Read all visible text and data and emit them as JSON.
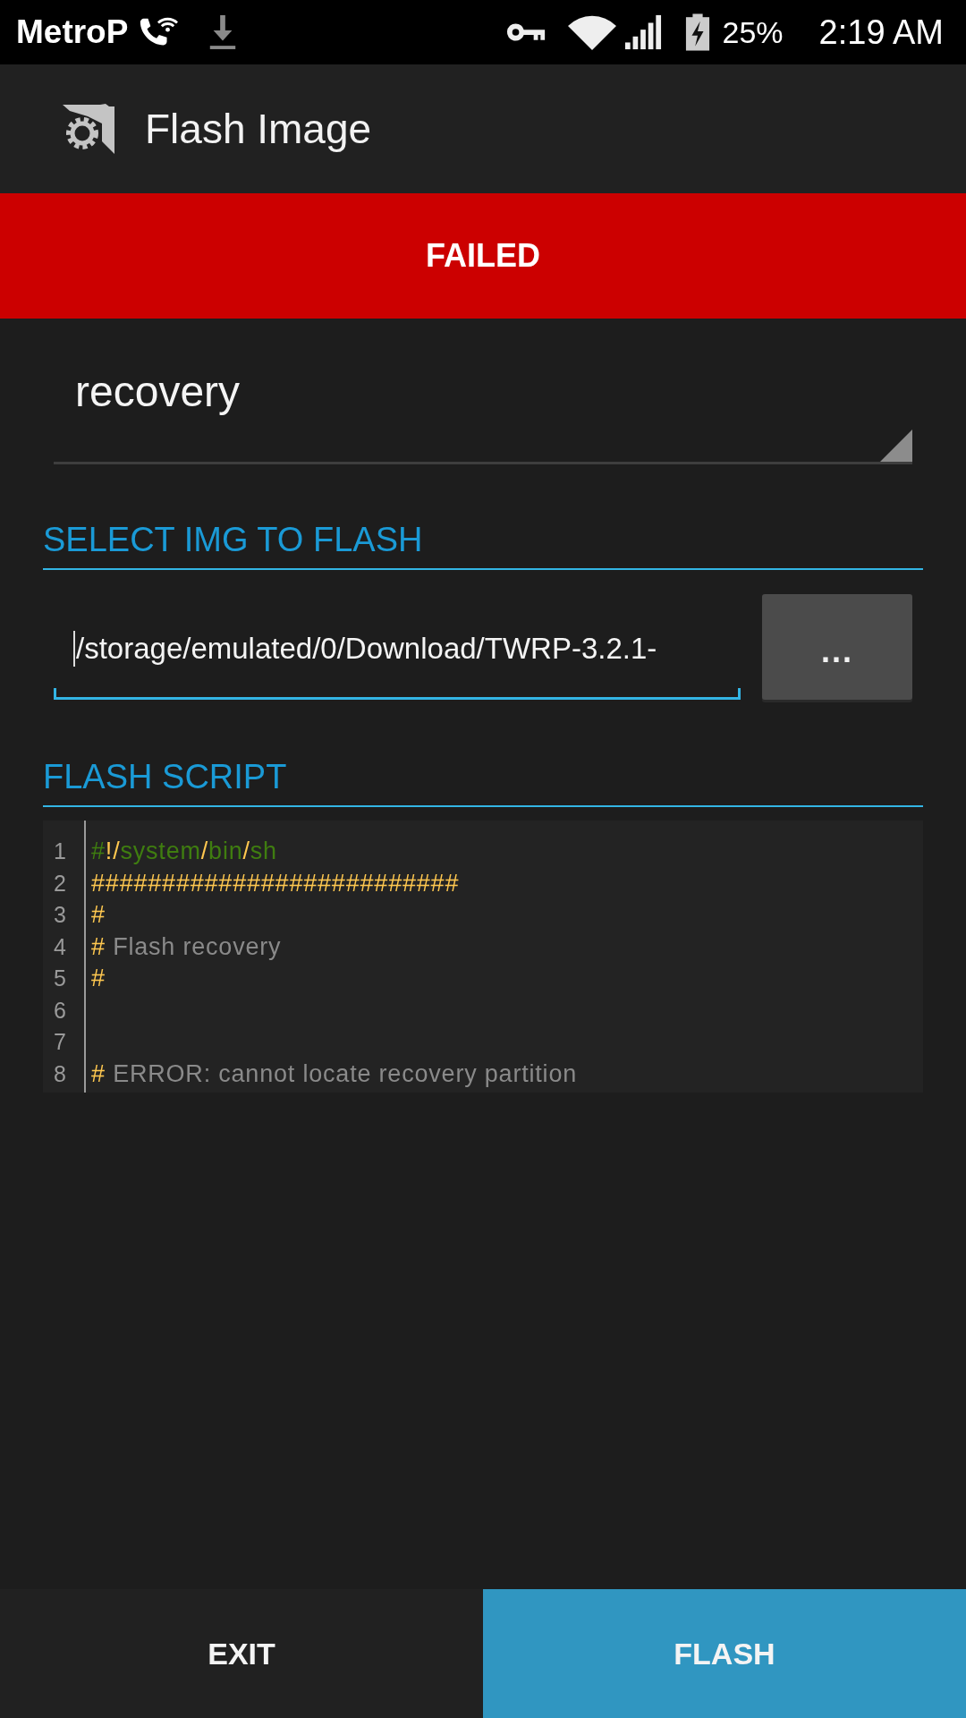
{
  "status_bar": {
    "carrier": "MetroP",
    "battery": "25%",
    "time": "2:19 AM"
  },
  "app_bar": {
    "title": "Flash Image"
  },
  "banner": {
    "label": "FAILED",
    "kind": "error"
  },
  "partition_dropdown": {
    "value": "recovery"
  },
  "select_image": {
    "header": "SELECT IMG TO FLASH",
    "path_field": {
      "value": "/storage/emulated/0/Download/TWRP-3.2.1-",
      "focused": true
    },
    "browse_button": {
      "label": "..."
    }
  },
  "flash_script": {
    "header": "FLASH SCRIPT",
    "lines": [
      {
        "number": "1",
        "tokens": [
          {
            "text": "#",
            "kind": "shebang"
          },
          {
            "text": "!/",
            "kind": "symbol"
          },
          {
            "text": "system",
            "kind": "shebang"
          },
          {
            "text": "/",
            "kind": "symbol"
          },
          {
            "text": "bin",
            "kind": "shebang"
          },
          {
            "text": "/",
            "kind": "symbol"
          },
          {
            "text": "sh",
            "kind": "shebang"
          }
        ]
      },
      {
        "number": "2",
        "tokens": [
          {
            "text": "##########################",
            "kind": "symbol"
          }
        ]
      },
      {
        "number": "3",
        "tokens": [
          {
            "text": "#",
            "kind": "symbol"
          }
        ]
      },
      {
        "number": "4",
        "tokens": [
          {
            "text": "#",
            "kind": "symbol"
          },
          {
            "text": " Flash recovery",
            "kind": "comment"
          }
        ]
      },
      {
        "number": "5",
        "tokens": [
          {
            "text": "#",
            "kind": "symbol"
          }
        ]
      },
      {
        "number": "6"
      },
      {
        "number": "7"
      },
      {
        "number": "8",
        "tokens": [
          {
            "text": "#",
            "kind": "symbol"
          },
          {
            "text": " ERROR: cannot locate recovery partition",
            "kind": "comment"
          }
        ]
      }
    ]
  },
  "buttons": [
    {
      "label": "EXIT",
      "kind": "secondary"
    },
    {
      "label": "FLASH",
      "kind": "primary"
    }
  ]
}
